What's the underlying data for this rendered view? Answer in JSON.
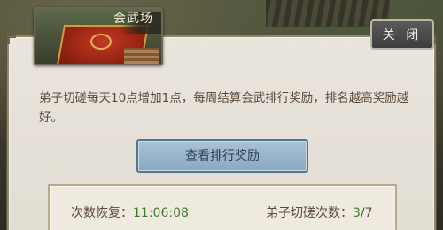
{
  "header": {
    "arena_title": "会武场",
    "close_label": "关 闭"
  },
  "description": "弟子切磋每天10点增加1点，每周结算会武排行奖励，排名越高奖励越好。",
  "rank_button_label": "查看排行奖励",
  "stats": {
    "recover_label": "次数恢复：",
    "recover_time": "11:06:08",
    "spar_label": "弟子切磋次数：",
    "spar_current": "3",
    "spar_total": "/7"
  },
  "colors": {
    "value_green": "#3e7a2a",
    "button_blue": "#8aa9c2",
    "text_brown": "#5b4a3a"
  }
}
